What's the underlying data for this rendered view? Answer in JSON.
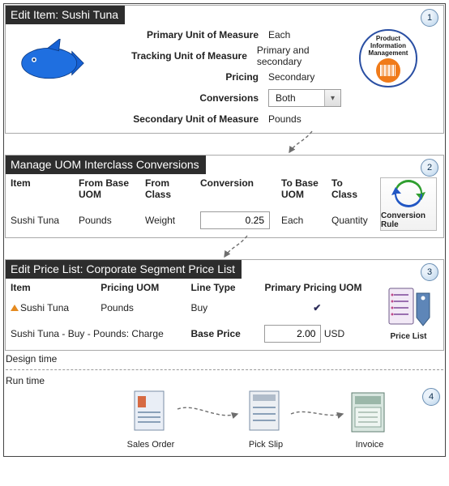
{
  "step_numbers": [
    "1",
    "2",
    "3",
    "4"
  ],
  "panel1": {
    "title": "Edit Item: Sushi Tuna",
    "attrs": {
      "primary_uom_label": "Primary Unit of Measure",
      "primary_uom_value": "Each",
      "tracking_uom_label": "Tracking Unit of Measure",
      "tracking_uom_value": "Primary and secondary",
      "pricing_label": "Pricing",
      "pricing_value": "Secondary",
      "conversions_label": "Conversions",
      "conversions_value": "Both",
      "secondary_uom_label": "Secondary Unit of Measure",
      "secondary_uom_value": "Pounds"
    },
    "pim": {
      "line1": "Product",
      "line2": "Information",
      "line3": "Management"
    }
  },
  "panel2": {
    "title": "Manage UOM Interclass Conversions",
    "headers": {
      "item": "Item",
      "from_base": "From Base UOM",
      "from_class": "From Class",
      "conversion": "Conversion",
      "to_base": "To Base UOM",
      "to_class": "To Class"
    },
    "row": {
      "item": "Sushi Tuna",
      "from_base": "Pounds",
      "from_class": "Weight",
      "conversion": "0.25",
      "to_base": "Each",
      "to_class": "Quantity"
    },
    "icon_label": "Conversion Rule"
  },
  "panel3": {
    "title": "Edit Price List: Corporate Segment Price List",
    "headers": {
      "item": "Item",
      "pricing_uom": "Pricing UOM",
      "line_type": "Line Type",
      "primary_pricing_uom": "Primary Pricing UOM"
    },
    "row": {
      "item": "Sushi Tuna",
      "pricing_uom": "Pounds",
      "line_type": "Buy"
    },
    "base_price_row": {
      "label": "Sushi Tuna - Buy - Pounds: Charge",
      "bp_label": "Base Price",
      "bp_value": "2.00",
      "bp_currency": "USD"
    },
    "icon_label": "Price List"
  },
  "bands": {
    "design": "Design time",
    "run": "Run time"
  },
  "runtime": {
    "sales_order": "Sales Order",
    "pick_slip": "Pick Slip",
    "invoice": "Invoice"
  }
}
